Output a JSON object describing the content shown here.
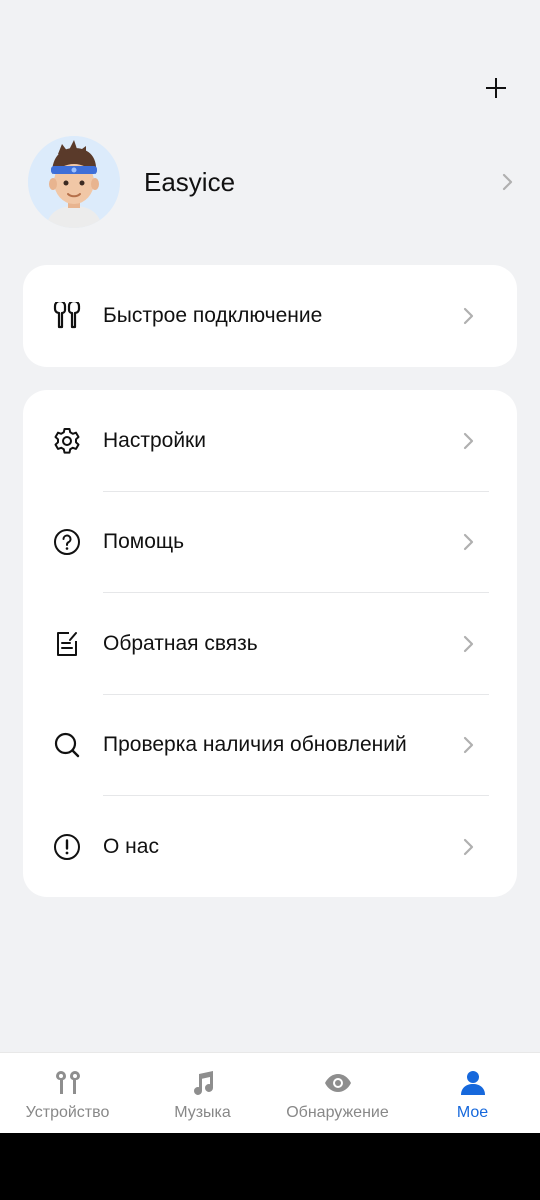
{
  "profile": {
    "name": "Easyice"
  },
  "quick_connect": {
    "label": "Быстрое подключение",
    "icon": "earbuds-icon"
  },
  "menu": [
    {
      "label": "Настройки",
      "icon": "gear-icon"
    },
    {
      "label": "Помощь",
      "icon": "help-icon"
    },
    {
      "label": "Обратная связь",
      "icon": "feedback-icon"
    },
    {
      "label": "Проверка наличия обновлений",
      "icon": "search-icon"
    },
    {
      "label": "О нас",
      "icon": "info-icon"
    }
  ],
  "tabs": [
    {
      "label": "Устройство",
      "icon": "earbuds-icon",
      "active": false
    },
    {
      "label": "Музыка",
      "icon": "music-note-icon",
      "active": false
    },
    {
      "label": "Обнаружение",
      "icon": "eye-icon",
      "active": false
    },
    {
      "label": "Мое",
      "icon": "person-icon",
      "active": true
    }
  ],
  "colors": {
    "background": "#f1f2f4",
    "accent": "#1668dc",
    "inactive_tab": "#888888"
  }
}
